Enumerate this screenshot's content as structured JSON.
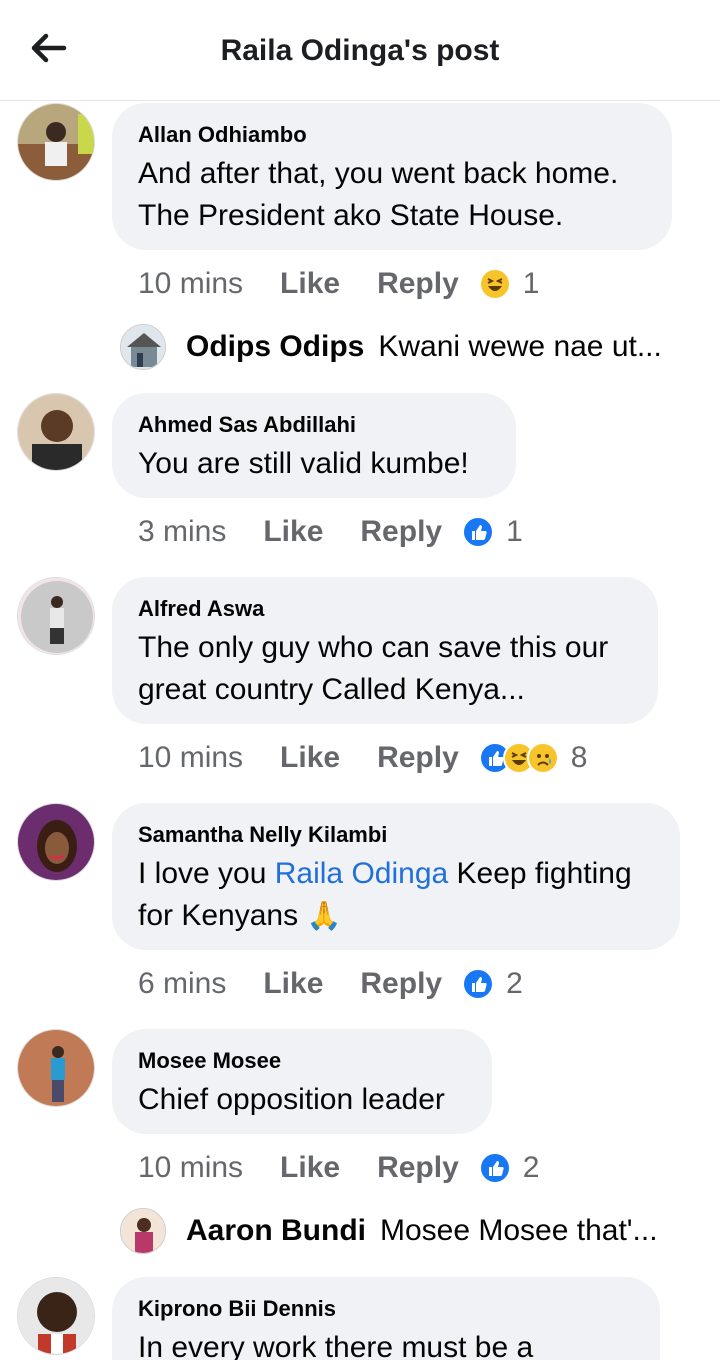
{
  "header": {
    "title": "Raila Odinga's post",
    "back_icon": "back-arrow-icon"
  },
  "comments": [
    {
      "author": "Allan Odhiambo",
      "lines": [
        "And after that, you went back home.",
        "The President ako State House."
      ],
      "time": "10 mins",
      "like": "Like",
      "reply": "Reply",
      "reactions": [
        "haha"
      ],
      "reaction_count": "1",
      "reply_preview": {
        "author": "Odips Odips",
        "text": "Kwani wewe nae ut..."
      }
    },
    {
      "author": "Ahmed Sas Abdillahi",
      "lines": [
        "You are still valid kumbe!"
      ],
      "time": "3 mins",
      "like": "Like",
      "reply": "Reply",
      "reactions": [
        "like"
      ],
      "reaction_count": "1"
    },
    {
      "author": "Alfred Aswa",
      "lines": [
        "The only guy who can save this our",
        "great country Called Kenya..."
      ],
      "time": "10 mins",
      "like": "Like",
      "reply": "Reply",
      "reactions": [
        "like",
        "haha",
        "sad"
      ],
      "reaction_count": "8"
    },
    {
      "author": "Samantha Nelly Kilambi",
      "line1_pre": "I love you ",
      "line1_mention": "Raila Odinga",
      "line1_post": " Keep fighting",
      "line2": "for Kenyans",
      "emoji": "🙏",
      "time": "6 mins",
      "like": "Like",
      "reply": "Reply",
      "reactions": [
        "like"
      ],
      "reaction_count": "2"
    },
    {
      "author": "Mosee Mosee",
      "lines": [
        "Chief opposition leader"
      ],
      "time": "10 mins",
      "like": "Like",
      "reply": "Reply",
      "reactions": [
        "like"
      ],
      "reaction_count": "2",
      "reply_preview": {
        "author": "Aaron Bundi",
        "text": "Mosee Mosee that'..."
      }
    },
    {
      "author": "Kiprono Bii Dennis",
      "lines": [
        "In every work there must be a"
      ]
    }
  ],
  "colors": {
    "accent": "#1877f2",
    "mention": "#216fdb",
    "bubble": "#f0f2f5",
    "meta": "#65676b"
  }
}
